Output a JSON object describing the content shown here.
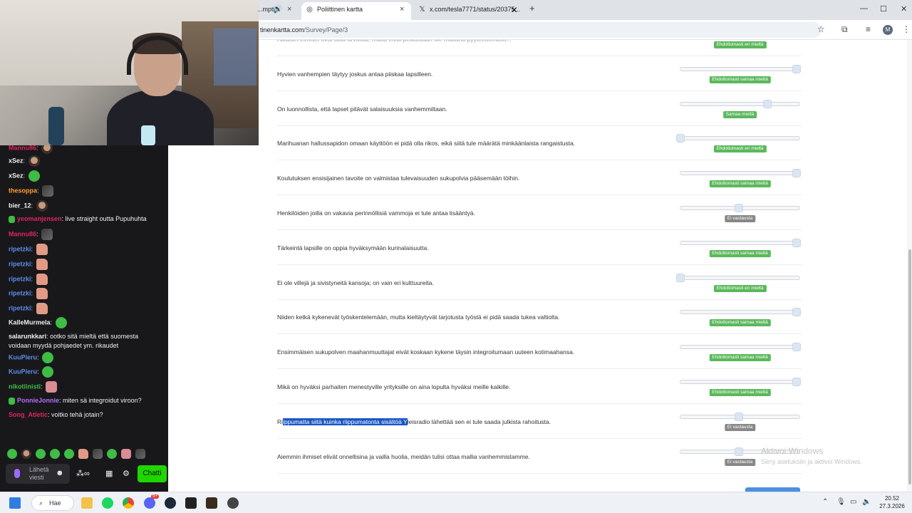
{
  "chat": {
    "messages": [
      {
        "user": "Mannu86",
        "user_color": "#e0245e",
        "emote": "face"
      },
      {
        "user": "xSez",
        "user_color": "#efeff1",
        "emote": "face"
      },
      {
        "user": "xSez",
        "user_color": "#efeff1",
        "emote": "frog"
      },
      {
        "user": "thesoppa",
        "user_color": "#ff9d2e",
        "emote": "dark"
      },
      {
        "user": "bier_12",
        "user_color": "#efeff1",
        "emote": "face"
      },
      {
        "user": "yeomanjensen",
        "user_color": "#e0245e",
        "text": "live straight outta Pupuhuhta",
        "badge": true
      },
      {
        "user": "Mannu86",
        "user_color": "#e0245e",
        "emote": "dark"
      },
      {
        "user": "ripetzki",
        "user_color": "#5b8def",
        "emote": "hand"
      },
      {
        "user": "ripetzki",
        "user_color": "#5b8def",
        "emote": "hand"
      },
      {
        "user": "ripetzki",
        "user_color": "#5b8def",
        "emote": "hand"
      },
      {
        "user": "ripetzki",
        "user_color": "#5b8def",
        "emote": "hand"
      },
      {
        "user": "ripetzki",
        "user_color": "#5b8def",
        "emote": "hand"
      },
      {
        "user": "KalleMurmela",
        "user_color": "#efeff1",
        "emote": "frog"
      },
      {
        "user": "salarunkkari",
        "user_color": "#efeff1",
        "text": "ootko sitä mieltä että suomesta voidaan myydä pohjaedet ym. rikaudet"
      },
      {
        "user": "KuuPieru",
        "user_color": "#5b8def",
        "emote": "frog"
      },
      {
        "user": "KuuPieru",
        "user_color": "#5b8def",
        "emote": "frog"
      },
      {
        "user": "nikotiinisti",
        "user_color": "#3ebc45",
        "emote": "pink"
      },
      {
        "user": "PonnieJonnie",
        "user_color": "#b66cff",
        "text": "miten sä integroidut viroon?",
        "badge": true
      },
      {
        "user": "Song_Atletic",
        "user_color": "#e0245e",
        "text": "voitko tehä jotain?"
      }
    ],
    "input_placeholder": "Lähetä viesti",
    "send_button": "Chatti"
  },
  "browser": {
    "tabs": [
      {
        "label": "...mpti",
        "active": false
      },
      {
        "label": "Poliittinen kartta",
        "active": true
      },
      {
        "label": "x.com/tesla7771/status/20375...",
        "active": false
      }
    ],
    "address": {
      "prefix": "tinenkartta.com",
      "path": "/Survey/Page/3"
    },
    "profile_initial": "M"
  },
  "survey": {
    "questions": [
      {
        "text": "Aikuiset ihmiset ovat tasa-arvoisia, mutta eivät pelkästään ole mukana pyyteettömästi...",
        "value": 0,
        "answer": "Ehdottomasti eri mieltä",
        "status": "green",
        "partial": true
      },
      {
        "text": "Hyvien vanhempien täytyy joskus antaa piiskaa lapsilleen.",
        "value": 1.0,
        "answer": "Ehdottomasti samaa mieltä",
        "status": "green"
      },
      {
        "text": "On luonnollista, että lapset pitävät salaisuuksia vanhemmiltaan.",
        "value": 0.75,
        "answer": "Samaa mieltä",
        "status": "green"
      },
      {
        "text": "Marihuanan hallussapidon omaan käyttöön ei pidä olla rikos, eikä siitä tule määrätä minkäänlaista rangaistusta.",
        "value": 0,
        "answer": "Ehdottomasti eri mieltä",
        "status": "green"
      },
      {
        "text": "Koulutuksen ensisijainen tavoite on valmistaa tulevaisuuden sukupolvia pääsemään töihin.",
        "value": 1.0,
        "answer": "Ehdottomasti samaa mieltä",
        "status": "green"
      },
      {
        "text": "Henkilöiden joilla on vakavia perinnöllisiä vammoja ei tule antaa lisääntyä.",
        "value": 0.5,
        "answer": "Ei vastausta",
        "status": "gray"
      },
      {
        "text": "Tärkeintä lapsille on oppia hyväksymään kurinalaisuutta.",
        "value": 1.0,
        "answer": "Ehdottomasti samaa mieltä",
        "status": "green"
      },
      {
        "text": "Ei ole villejä ja sivistyneitä kansoja; on vain eri kulttuureita.",
        "value": 0,
        "answer": "Ehdottomasti eri mieltä",
        "status": "green"
      },
      {
        "text": "Niiden ketkä kykenevät työskentelemään, mutta kieltäytyvät tarjotusta työstä ei pidä saada tukea valtiolta.",
        "value": 1.0,
        "answer": "Ehdottomasti samaa mieltä",
        "status": "green"
      },
      {
        "text": "Ensimmäisen sukupolven maahanmuuttajat eivät koskaan kykene täysin integroitumaan uuteen kotimaahansa.",
        "value": 1.0,
        "answer": "Ehdottomasti samaa mieltä",
        "status": "green"
      },
      {
        "text": "Mikä on hyväksi parhaiten menestyville yrityksille on aina lopulta hyväksi meille kaikille.",
        "value": 1.0,
        "answer": "Ehdottomasti samaa mieltä",
        "status": "green"
      },
      {
        "text_pre": "Ri",
        "text_sel": "ippumatta siitä kuinka riippumatonta sisältöä Y",
        "text_post": "leisradio lähettää sen ei tule saada julkista rahoitusta.",
        "value": 0.5,
        "answer": "Ei vastausta",
        "status": "gray",
        "selected": true
      },
      {
        "text": "Aiemmin ihmiset elivät onnellisina ja vailla huolia, meidän tulisi ottaa mallia vanhemmistamme.",
        "value": 0.5,
        "answer": "Ei vastausta",
        "status": "gray"
      }
    ]
  },
  "watermark": {
    "title": "Aktivoi Windows",
    "subtitle": "Siirry asetuksiin ja aktivoi Windows."
  },
  "taskbar": {
    "search_label": "Hae",
    "time": "20.52",
    "date": "27.3.2026",
    "discord_badge": "9+"
  },
  "colors": {
    "accent_green": "#5cb85c",
    "gray_badge": "#888888",
    "chat_bg": "#18181b",
    "chatti_green": "#1fd600"
  }
}
